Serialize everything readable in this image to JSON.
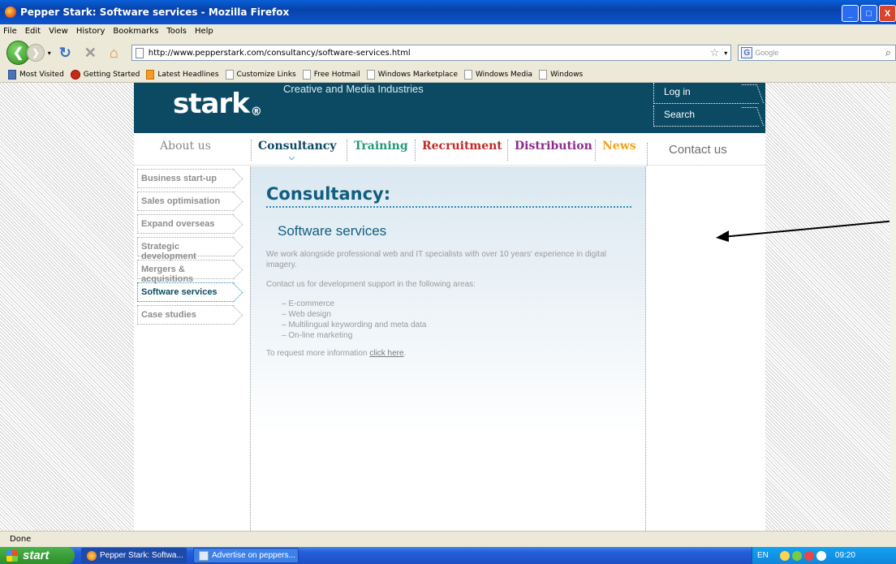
{
  "window": {
    "title": "Pepper Stark: Software services - Mozilla Firefox",
    "controls": [
      "_",
      "□",
      "X"
    ]
  },
  "menu": [
    "File",
    "Edit",
    "View",
    "History",
    "Bookmarks",
    "Tools",
    "Help"
  ],
  "navbar": {
    "url": "http://www.pepperstark.com/consultancy/software-services.html",
    "search_engine": "G",
    "search_placeholder": "Google"
  },
  "bookmarks": [
    "Most Visited",
    "Getting Started",
    "Latest Headlines",
    "Customize Links",
    "Free Hotmail",
    "Windows Marketplace",
    "Windows Media",
    "Windows"
  ],
  "site": {
    "logo": "stark",
    "logo_mark": "®",
    "tagline": "Creative and Media Industries",
    "header_links": {
      "login": "Log in",
      "search": "Search"
    },
    "nav": {
      "about": "About us",
      "consultancy": "Consultancy",
      "training": "Training",
      "recruitment": "Recruitment",
      "distribution": "Distribution",
      "news": "News",
      "contact": "Contact us"
    },
    "sidebar": [
      "Business start-up",
      "Sales optimisation",
      "Expand overseas",
      "Strategic development",
      "Mergers & acquisitions",
      "Software services",
      "Case studies"
    ],
    "sidebar_active_index": 5,
    "main": {
      "title": "Consultancy:",
      "subtitle": "Software services",
      "intro": "We work alongside professional web and IT specialists with over 10 years' experience in digital imagery.",
      "contact_line": "Contact us for development support in the following areas:",
      "bullets": [
        "E-commerce",
        "Web design",
        "Multilingual keywording and meta data",
        "On-line marketing"
      ],
      "request_prefix": "To request more information ",
      "request_link": "click here",
      "request_suffix": "."
    }
  },
  "status": "Done",
  "taskbar": {
    "start": "start",
    "tasks": [
      "Pepper Stark: Softwa...",
      "Advertise on peppers..."
    ],
    "lang": "EN",
    "clock": "09:20"
  },
  "colors": {
    "header_bg": "#0c4a63",
    "consultancy": "#0c4a63",
    "training": "#259a7a",
    "recruitment": "#c02a2a",
    "distribution": "#8b2c8b",
    "news": "#f2a21c",
    "title_blue": "#125e7f"
  }
}
